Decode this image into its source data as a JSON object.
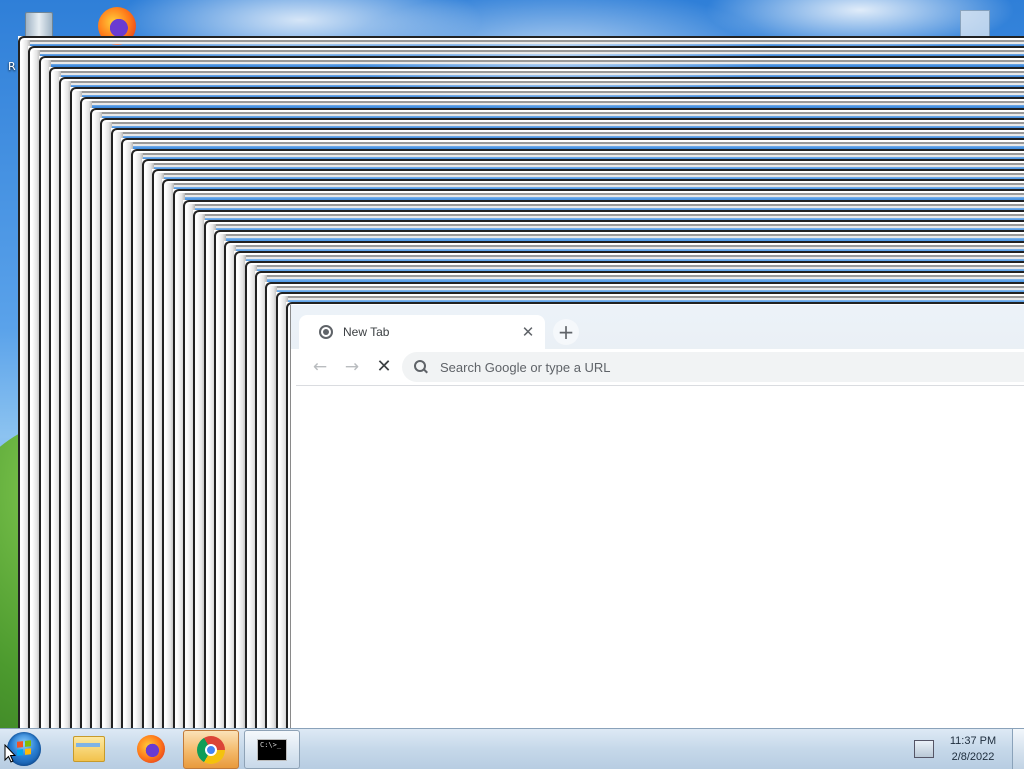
{
  "desktop": {
    "icons": [
      {
        "name": "recycle-bin-icon"
      },
      {
        "name": "firefox-icon"
      }
    ],
    "partial_label": "R"
  },
  "browser": {
    "tab": {
      "title": "New Tab",
      "close": "✕"
    },
    "new_tab": "+",
    "toolbar": {
      "back": "←",
      "forward": "→",
      "stop": "✕"
    },
    "omnibox": {
      "placeholder": "Search Google or type a URL",
      "value": ""
    }
  },
  "taskbar": {
    "apps": [
      {
        "name": "windows-explorer-icon"
      },
      {
        "name": "firefox-icon"
      },
      {
        "name": "chrome-icon",
        "active": true
      },
      {
        "name": "command-prompt-icon",
        "text": "C:\\>_"
      }
    ],
    "tray": {
      "time": "11:37 PM",
      "date": "2/8/2022"
    }
  },
  "colors": {
    "active_task": "#f4b96a",
    "chrome_bg": "#ffffff",
    "omnibox_bg": "#f1f3f4"
  }
}
